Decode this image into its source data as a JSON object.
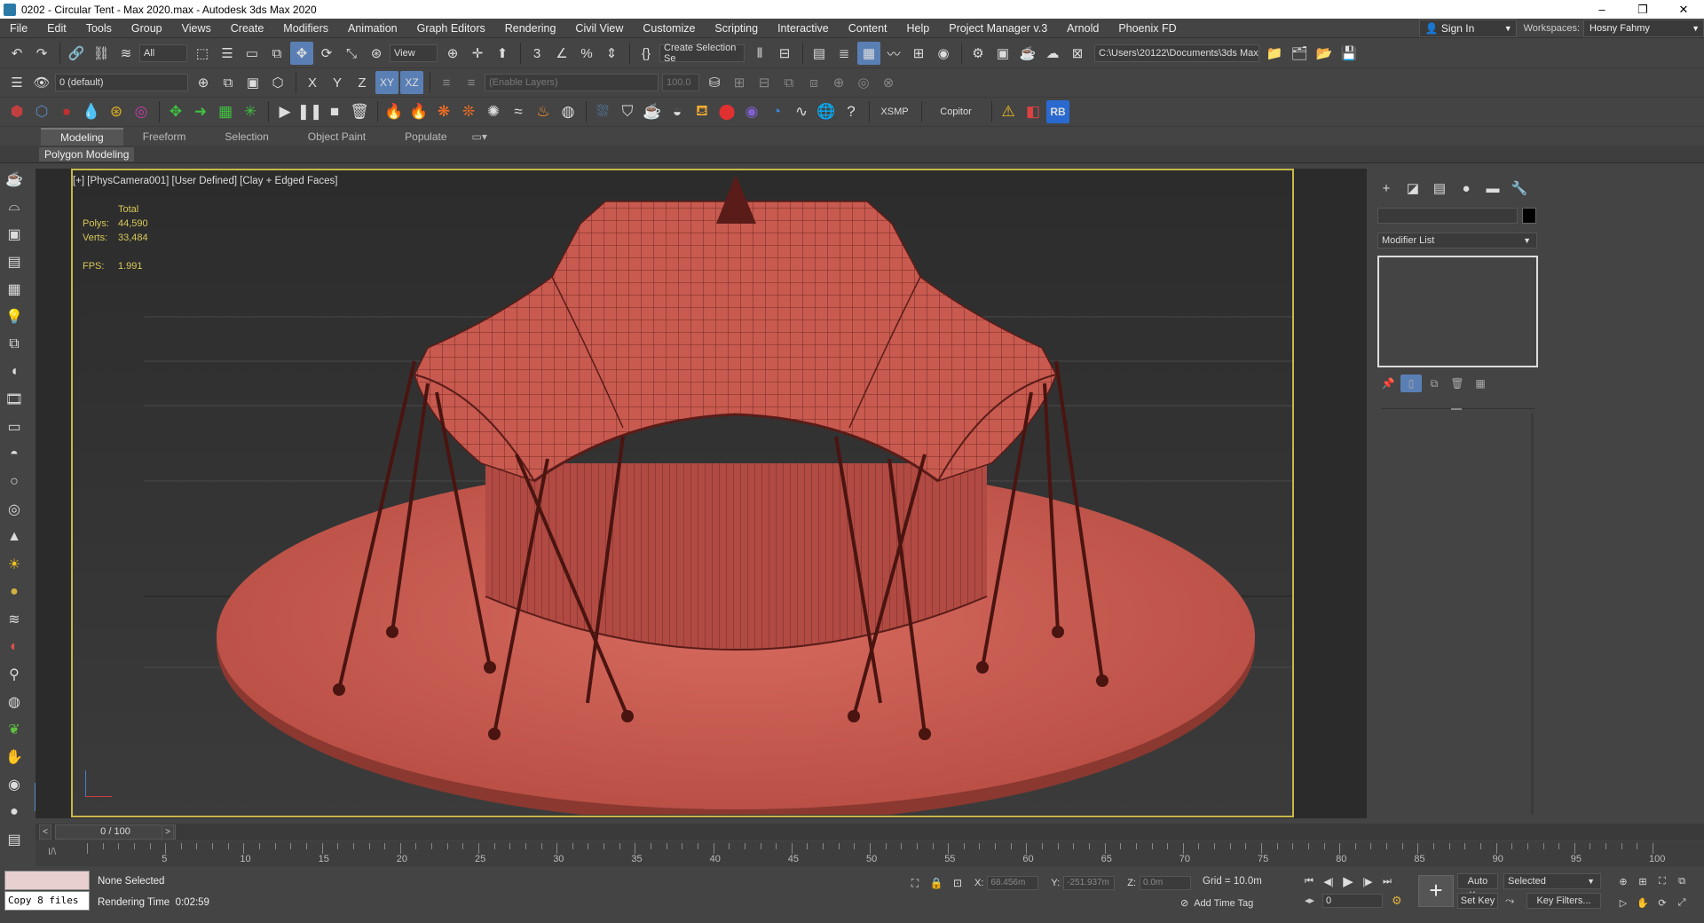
{
  "window": {
    "title": "0202 - Circular Tent - Max 2020.max - Autodesk 3ds Max 2020",
    "controls": [
      "–",
      "❐",
      "✕"
    ]
  },
  "menu": {
    "items": [
      "File",
      "Edit",
      "Tools",
      "Group",
      "Views",
      "Create",
      "Modifiers",
      "Animation",
      "Graph Editors",
      "Rendering",
      "Civil View",
      "Customize",
      "Scripting",
      "Interactive",
      "Content",
      "Help",
      "Project Manager v.3",
      "Arnold",
      "Phoenix FD"
    ],
    "sign_in": "Sign In",
    "workspaces_label": "Workspaces:",
    "workspace_value": "Hosny Fahmy"
  },
  "toolbar1": {
    "filter_value": "All",
    "view_value": "View",
    "selection_set_value": "Create Selection Se",
    "path_value": "C:\\Users\\20122\\Documents\\3ds Max 2020"
  },
  "toolbar2": {
    "layer_value": "0 (default)",
    "axis_x": "X",
    "axis_y": "Y",
    "axis_z": "Z",
    "axis_xy": "XY",
    "axis_xz": "XZ",
    "enable_layers": "(Enable Layers)",
    "percent_value": "100.0"
  },
  "toolbar3": {
    "xsmp": "XSMP",
    "copitor": "Copitor",
    "rb": "RB"
  },
  "ribbon": {
    "tabs": [
      "Modeling",
      "Freeform",
      "Selection",
      "Object Paint",
      "Populate"
    ],
    "active_panel": "Polygon Modeling"
  },
  "viewport": {
    "label": "[+] [PhysCamera001] [User Defined] [Clay + Edged Faces]",
    "stats": {
      "total_label": "Total",
      "polys_label": "Polys:",
      "polys_value": "44,590",
      "verts_label": "Verts:",
      "verts_value": "33,484",
      "fps_label": "FPS:",
      "fps_value": "1.991"
    },
    "colors": {
      "model": "#c85a50",
      "wire": "#5a1c18",
      "border": "#c8b84a"
    }
  },
  "command_panel": {
    "modifier_list": "Modifier List"
  },
  "timeline": {
    "slider_value": "0 / 100",
    "ticks": [
      0,
      5,
      10,
      15,
      20,
      25,
      30,
      35,
      40,
      45,
      50,
      55,
      60,
      65,
      70,
      75,
      80,
      85,
      90,
      95,
      100
    ]
  },
  "status": {
    "selection_text": "None Selected",
    "rendering_time_label": "Rendering Time",
    "rendering_time_value": "0:02:59",
    "maxscript_output": "Copy 8 files",
    "x_label": "X:",
    "x_value": "68.456m",
    "y_label": "Y:",
    "y_value": "-251.937m",
    "z_label": "Z:",
    "z_value": "0.0m",
    "grid": "Grid = 10.0m",
    "add_time_tag": "Add Time Tag",
    "frame_value": "0",
    "auto_key": "Auto Key",
    "set_key": "Set Key",
    "selected_dropdown": "Selected",
    "key_filters": "Key Filters..."
  }
}
